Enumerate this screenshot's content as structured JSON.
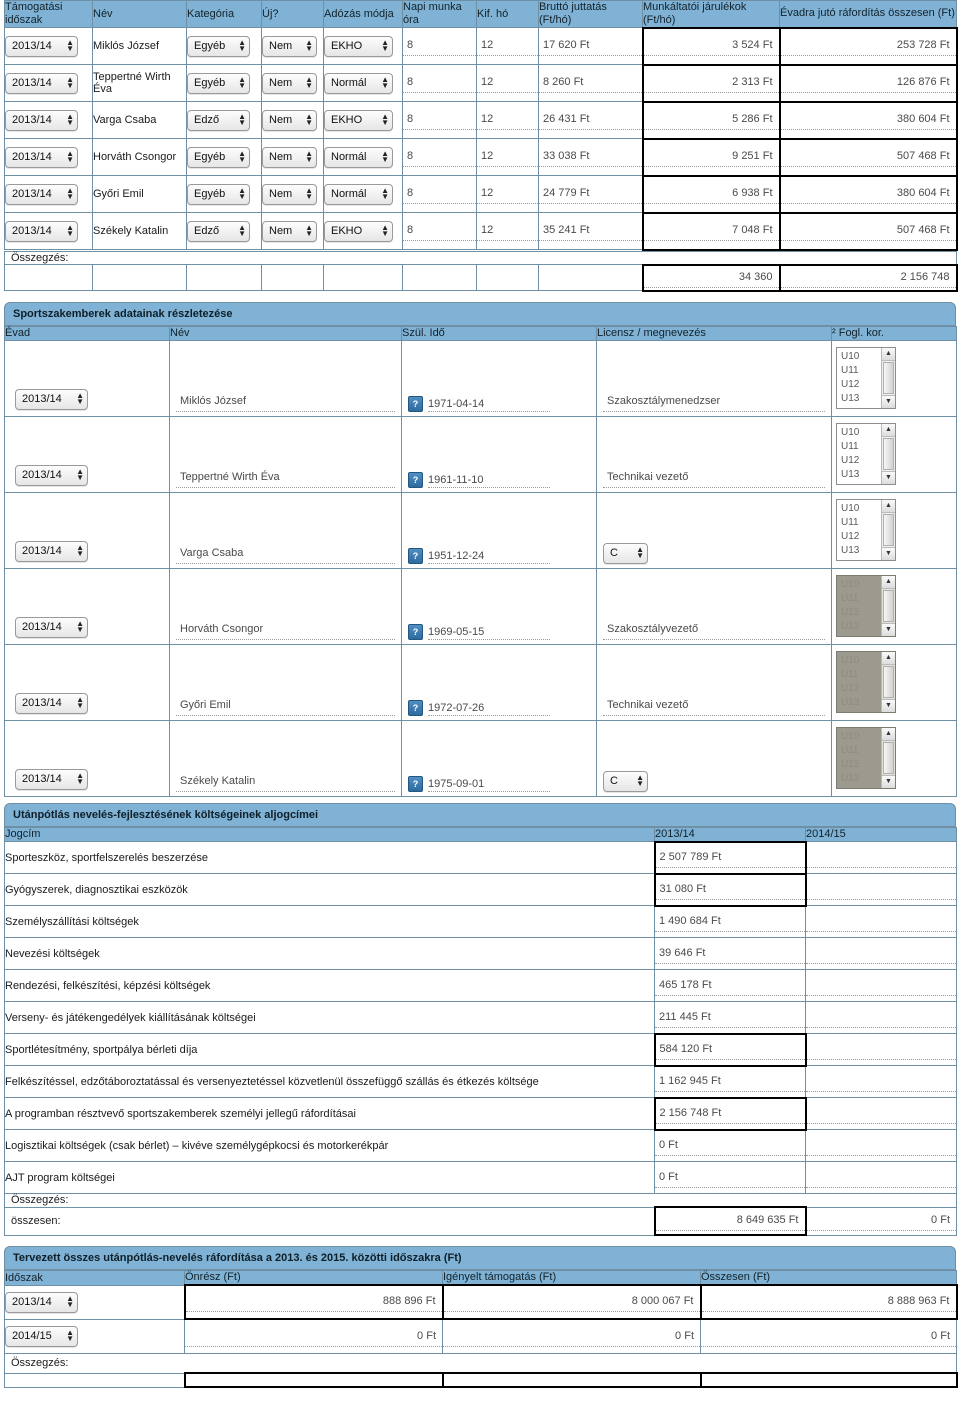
{
  "staff_cost_table": {
    "columns": [
      "Támogatási időszak",
      "Név",
      "Kategória",
      "Új?",
      "Adózás módja",
      "Napi munka óra",
      "Kif. hó",
      "Bruttó juttatás (Ft/hó)",
      "Munkáltatói járulékok (Ft/hó)",
      "Évadra jutó ráfordítás összesen (Ft)"
    ],
    "rows": [
      {
        "season": "2013/14",
        "name": "Miklós József",
        "category": "Egyéb",
        "new": "Nem",
        "tax": "EKHO",
        "hours": "8",
        "months": "12",
        "gross": "17 620 Ft",
        "contrib": "3 524  Ft",
        "total": "253 728  Ft"
      },
      {
        "season": "2013/14",
        "name": "Teppertné Wirth Éva",
        "category": "Egyéb",
        "new": "Nem",
        "tax": "Normál",
        "hours": "8",
        "months": "12",
        "gross": "8 260 Ft",
        "contrib": "2 313  Ft",
        "total": "126 876  Ft"
      },
      {
        "season": "2013/14",
        "name": "Varga Csaba",
        "category": "Edző",
        "new": "Nem",
        "tax": "EKHO",
        "hours": "8",
        "months": "12",
        "gross": "26 431 Ft",
        "contrib": "5 286  Ft",
        "total": "380 604  Ft"
      },
      {
        "season": "2013/14",
        "name": "Horváth Csongor",
        "category": "Egyéb",
        "new": "Nem",
        "tax": "Normál",
        "hours": "8",
        "months": "12",
        "gross": "33 038 Ft",
        "contrib": "9 251  Ft",
        "total": "507 468  Ft"
      },
      {
        "season": "2013/14",
        "name": "Győri Emil",
        "category": "Egyéb",
        "new": "Nem",
        "tax": "Normál",
        "hours": "8",
        "months": "12",
        "gross": "24 779 Ft",
        "contrib": "6 938  Ft",
        "total": "380 604  Ft"
      },
      {
        "season": "2013/14",
        "name": "Székely Katalin",
        "category": "Edző",
        "new": "Nem",
        "tax": "EKHO",
        "hours": "8",
        "months": "12",
        "gross": "35 241 Ft",
        "contrib": "7 048  Ft",
        "total": "507 468  Ft"
      }
    ],
    "summary_label": "Összegzés:",
    "summary": {
      "contrib": "34 360",
      "total": "2 156 748"
    }
  },
  "staff_details": {
    "title": "Sportszakemberek adatainak részletezése",
    "columns": [
      "Évad",
      "Név",
      "Szül. Idő",
      "Licensz / megnevezés",
      "² Fogl. kor."
    ],
    "listbox_options": [
      "U10",
      "U11",
      "U12",
      "U13"
    ],
    "rows": [
      {
        "season": "2013/14",
        "name": "Miklós József",
        "birth": "1971-04-14",
        "license": "Szakosztálymenedzser",
        "license_type": "text",
        "agegroup_disabled": false
      },
      {
        "season": "2013/14",
        "name": "Teppertné Wirth Éva",
        "birth": "1961-11-10",
        "license": "Technikai vezető",
        "license_type": "text",
        "agegroup_disabled": false
      },
      {
        "season": "2013/14",
        "name": "Varga Csaba",
        "birth": "1951-12-24",
        "license": "C",
        "license_type": "select",
        "agegroup_disabled": false
      },
      {
        "season": "2013/14",
        "name": "Horváth Csongor",
        "birth": "1969-05-15",
        "license": "Szakosztályvezető",
        "license_type": "text",
        "agegroup_disabled": true
      },
      {
        "season": "2013/14",
        "name": "Győri Emil",
        "birth": "1972-07-26",
        "license": "Technikai vezető",
        "license_type": "text",
        "agegroup_disabled": true
      },
      {
        "season": "2013/14",
        "name": "Székely Katalin",
        "birth": "1975-09-01",
        "license": "C",
        "license_type": "select",
        "agegroup_disabled": true
      }
    ]
  },
  "youth_costs": {
    "title": "Utánpótlás nevelés-fejlesztésének költségeinek aljogcímei",
    "columns": [
      "Jogcím",
      "2013/14",
      "2014/15"
    ],
    "rows": [
      {
        "item": "Sporteszköz, sportfelszerelés beszerzése",
        "y1": "2 507 789  Ft",
        "y2": "",
        "emph": true
      },
      {
        "item": "Gyógyszerek, diagnosztikai eszközök",
        "y1": "31 080  Ft",
        "y2": "",
        "emph": true
      },
      {
        "item": "Személyszállítási költségek",
        "y1": "1 490 684 Ft",
        "y2": "",
        "emph": false
      },
      {
        "item": "Nevezési költségek",
        "y1": "39 646 Ft",
        "y2": "",
        "emph": false
      },
      {
        "item": "Rendezési, felkészítési, képzési költségek",
        "y1": "465 178 Ft",
        "y2": "",
        "emph": false
      },
      {
        "item": "Verseny- és játékengedélyek kiállításának költségei",
        "y1": "211 445 Ft",
        "y2": "",
        "emph": false
      },
      {
        "item": "Sportlétesítmény, sportpálya bérleti díja",
        "y1": "584 120  Ft",
        "y2": "",
        "emph": true
      },
      {
        "item": "Felkészítéssel, edzőtáboroztatással és versenyeztetéssel közvetlenül összefüggő szállás és étkezés költsége",
        "y1": "1 162 945 Ft",
        "y2": "",
        "emph": false
      },
      {
        "item": "A programban résztvevő sportszakemberek személyi jellegű ráfordításai",
        "y1": "2 156 748  Ft",
        "y2": "",
        "emph": true
      },
      {
        "item": "Logisztikai költségek (csak bérlet) – kivéve személygépkocsi és motorkerékpár",
        "y1": "0 Ft",
        "y2": "",
        "emph": false
      },
      {
        "item": "AJT program költségei",
        "y1": "0 Ft",
        "y2": "",
        "emph": false
      }
    ],
    "summary_label": "Összegzés:",
    "total_label": "összesen:",
    "total": {
      "y1": "8 649 635 Ft",
      "y2": "0 Ft"
    }
  },
  "planned_total": {
    "title": "Tervezett összes utánpótlás-nevelés ráfordítása a 2013. és 2015. közötti időszakra (Ft)",
    "columns": [
      "Időszak",
      "Önrész (Ft)",
      "Igényelt támogatás (Ft)",
      "Összesen (Ft)"
    ],
    "rows": [
      {
        "period": "2013/14",
        "own": "888 896 Ft",
        "grant": "8 000 067 Ft",
        "total": "8 888 963 Ft",
        "emph": true
      },
      {
        "period": "2014/15",
        "own": "0 Ft",
        "grant": "0 Ft",
        "total": "0 Ft",
        "emph": false
      }
    ],
    "summary_label": "Összegzés:"
  },
  "icons": {
    "spinner": "▲▼",
    "date": "?",
    "scroll_up": "▲",
    "scroll_down": "▼"
  }
}
